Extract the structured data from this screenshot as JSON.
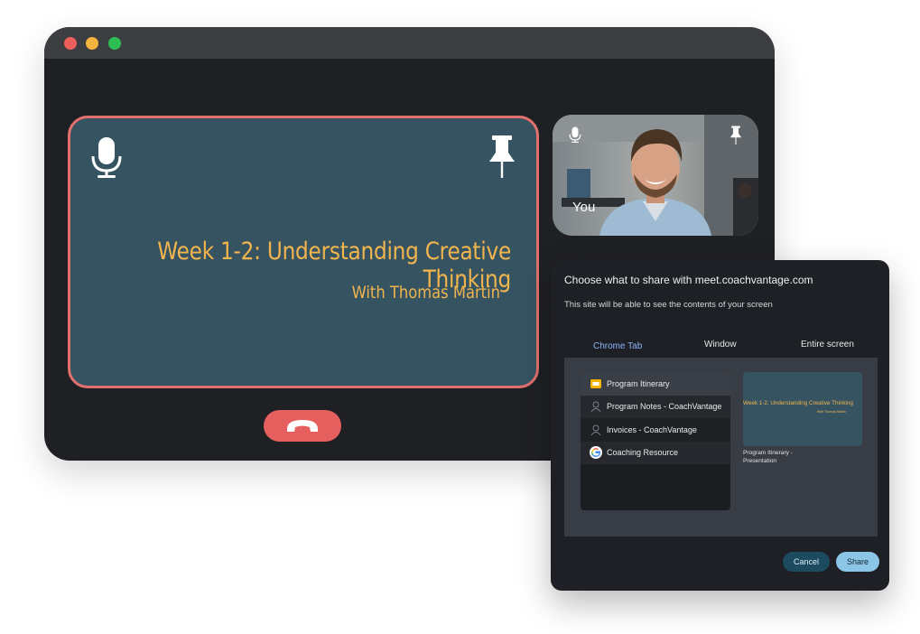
{
  "call": {
    "slide_title": "Week 1-2: Understanding Creative Thinking",
    "slide_subtitle": "With Thomas Martin",
    "self_label": "You"
  },
  "icons": {
    "stage_mic": "microphone-icon",
    "stage_pin": "pin-icon",
    "self_mic": "microphone-icon",
    "self_pin": "pin-icon",
    "hangup": "phone-hangup-icon"
  },
  "share": {
    "heading": "Choose what to share with meet.coachvantage.com",
    "subheading": "This site will be able to see the contents of your screen",
    "tabs": [
      {
        "label": "Chrome Tab",
        "active": true
      },
      {
        "label": "Window",
        "active": false
      },
      {
        "label": "Entire screen",
        "active": false
      }
    ],
    "items": [
      {
        "label": "Program Itinerary",
        "icon": "slides-icon"
      },
      {
        "label": "Program Notes - CoachVantage",
        "icon": "person-icon"
      },
      {
        "label": "Invoices - CoachVantage",
        "icon": "person-icon"
      },
      {
        "label": "Coaching Resource",
        "icon": "google-icon"
      }
    ],
    "preview_title": "Week 1-2: Understanding Creative Thinking",
    "preview_subtitle": "With Thomas Martin",
    "preview_caption": "Program Itinerary - Presentation",
    "cancel_label": "Cancel",
    "share_label": "Share"
  },
  "colors": {
    "stage_bg": "#365361",
    "stage_border": "#e2706d",
    "slide_text": "#f2b54e",
    "hangup": "#e45f5d",
    "active_tab": "#8ab4f8",
    "share_button": "#8cc6e6",
    "cancel_button": "#1c4a5f"
  }
}
